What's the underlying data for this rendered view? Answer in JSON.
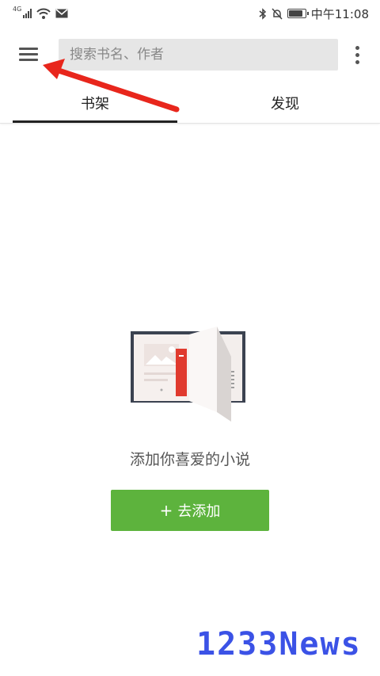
{
  "status_bar": {
    "network": "4G",
    "time": "中午11:08",
    "battery_level": 0.85
  },
  "toolbar": {
    "menu_icon": "menu-icon",
    "search_placeholder": "搜索书名、作者",
    "more_icon": "more-vert-icon"
  },
  "tabs": [
    {
      "label": "书架",
      "active": true
    },
    {
      "label": "发现",
      "active": false
    }
  ],
  "empty_state": {
    "illustration": "open-book-illustration",
    "message": "添加你喜爱的小说",
    "add_button_icon": "+",
    "add_button_label": "去添加"
  },
  "colors": {
    "accent_green": "#5db33d",
    "arrow_red": "#e8261c",
    "watermark_blue": "#3b52e6"
  },
  "watermark": "1233News"
}
